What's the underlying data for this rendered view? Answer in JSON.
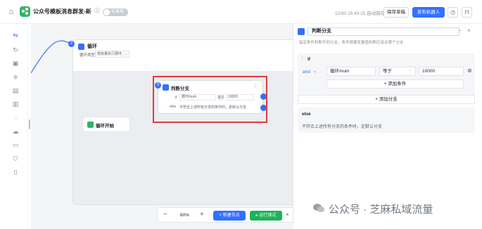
{
  "topbar": {
    "app_title": "公众号模板消息群发-新",
    "toggle_label": "未发布",
    "save_time": "12/30 15:43:15 自动保存草稿",
    "save_draft_label": "保存草稿",
    "publish_label": "发布机器人"
  },
  "canvas": {
    "loop_node": {
      "title": "循环",
      "type_label": "循环类型",
      "type_value": "按批量执行循环"
    },
    "start_node": {
      "title": "循环开始"
    },
    "branch_node": {
      "title": "判断分支",
      "if_label": "if",
      "var": "循环/num",
      "op": "等于",
      "value": "10000",
      "else_label": "else",
      "else_text": "不符合上述所有分支的条件时，走默认分支"
    },
    "port_badges": {
      "loop": "2",
      "branch": "3"
    },
    "zoom": {
      "minus": "−",
      "percent": "80%",
      "plus": "+",
      "add_node": "+ 新建节点",
      "run_test": "▸ 运行测试",
      "close": "×"
    }
  },
  "panel": {
    "title": "判断分支",
    "description": "指定条件判断不同分支，条件根据变量值判断应该走哪个分支",
    "if_label": "if",
    "logic": "and",
    "condition": {
      "variable": "循环/num",
      "operator": "等于",
      "value": "10000"
    },
    "add_condition": "+ 添加条件",
    "add_branch": "+ 添加分支",
    "else_label": "else",
    "else_text": "不符合上述所有分支的条件时，走默认分支"
  },
  "watermark": {
    "text": "公众号 · 芝麻私域流量"
  },
  "colors": {
    "accent": "#3370ff",
    "success": "#34b26a",
    "highlight": "#e23b3b"
  }
}
